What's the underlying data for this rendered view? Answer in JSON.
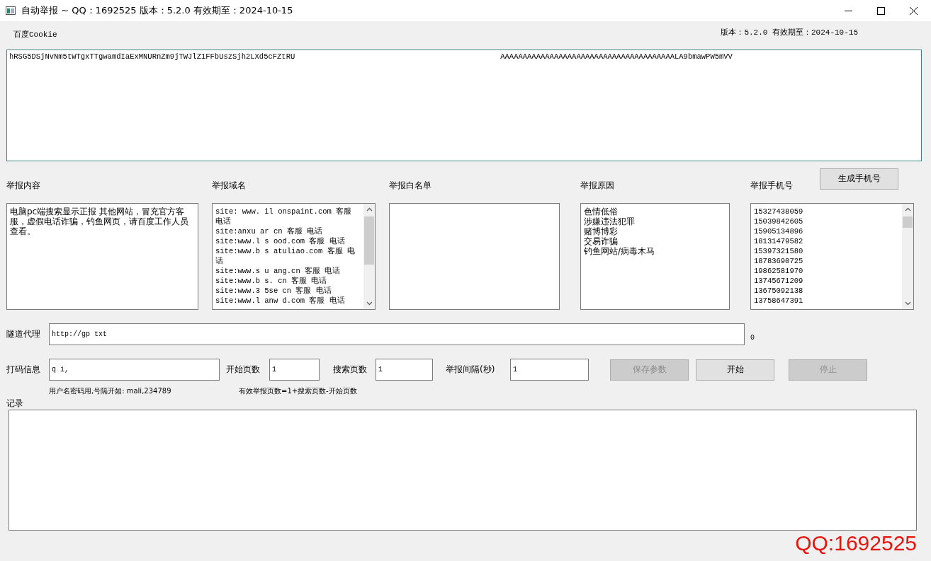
{
  "window": {
    "title": "自动举报 ~ QQ：1692525 版本：5.2.0 有效期至：2024-10-15"
  },
  "version_label": "版本：5.2.0 有效期至：2024-10-15",
  "cookie": {
    "label": "百度Cookie",
    "value_start": "hRSG5DSjNvNm5tWTgxTTgwamdIaExMNURnZm9jTWJlZ1FFbUszSjh2LXd5cFZtRU",
    "value_end": "AAAAAAAAAAAAAAAAAAAAAAAAAAAAAAAAAAAAAAALA9bmawPW5mVV"
  },
  "panels": [
    {
      "kind": "text",
      "label": "举报内容",
      "text": "电脑pc端搜索显示正报          其他网站，冒充官方客服，虚假电话诈骗，钓鱼网页，请百度工作人员查看。"
    },
    {
      "kind": "scroll",
      "label": "举报域名",
      "lines": [
        "site: www.  il  onspaint.com 客服",
        "电话",
        "site:anxu  ar  cn 客服 电话",
        "site:www.l  s  ood.com 客服 电话",
        "site:www.b  s  atuliao.com 客服 电",
        "话",
        "site:www.s  u  ang.cn 客服 电话",
        "site:www.b  s.  cn 客服 电话",
        "site:www.3  5se  cn 客服 电话",
        "site:www.l  anw  d.com 客服 电话"
      ]
    },
    {
      "kind": "text",
      "label": "举报白名单"
    },
    {
      "kind": "lines",
      "label": "举报原因",
      "lines": [
        "色情低俗",
        "涉嫌违法犯罪",
        "赌博博彩",
        "交易诈骗",
        "钓鱼网站/病毒木马"
      ]
    },
    {
      "kind": "scroll",
      "label": "举报手机号",
      "button": "生成手机号",
      "lines": [
        "15327438059",
        "15039842605",
        "15905134896",
        "18131479582",
        "15397321580",
        "18783690725",
        "19862581970",
        "13745671209",
        "13675092138",
        "13758647391"
      ]
    }
  ],
  "proxy": {
    "label": "隧道代理",
    "value": "http://gp          txt",
    "count": "0"
  },
  "captcha": {
    "label": "打码信息",
    "value": "q       i,",
    "hint": "用户名密码用,号隔开如: mali,234789"
  },
  "start_page": {
    "label": "开始页数",
    "value": "1"
  },
  "search_pages": {
    "label": "搜索页数",
    "value": "1",
    "hint": "有效举报页数=1+搜索页数-开始页数"
  },
  "interval": {
    "label": "举报间隔(秒)",
    "value": "1"
  },
  "buttons": [
    {
      "label": "保存参数",
      "disabled": true
    },
    {
      "label": "开始",
      "disabled": false
    },
    {
      "label": "停止",
      "disabled": true
    }
  ],
  "log": {
    "label": "记录"
  },
  "footer": "QQ:1692525"
}
